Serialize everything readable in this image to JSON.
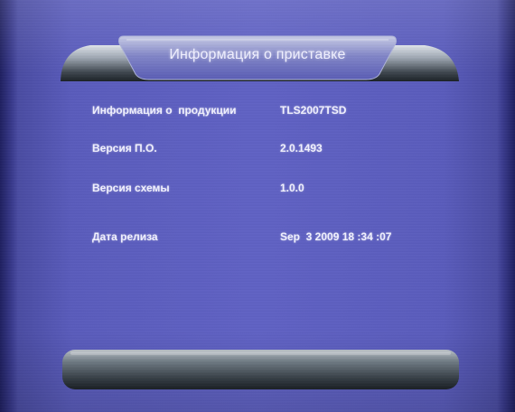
{
  "header": {
    "title": "Информация о приставке"
  },
  "info_rows": [
    {
      "label": "Информация о  продукции",
      "value": "TLS2007TSD"
    },
    {
      "label": "Версия П.О.",
      "value": "2.0.1493"
    },
    {
      "label": "Версия схемы",
      "value": "1.0.0"
    },
    {
      "label": "Дата релиза",
      "value": "Sep  3 2009 18 :34 :07"
    }
  ]
}
